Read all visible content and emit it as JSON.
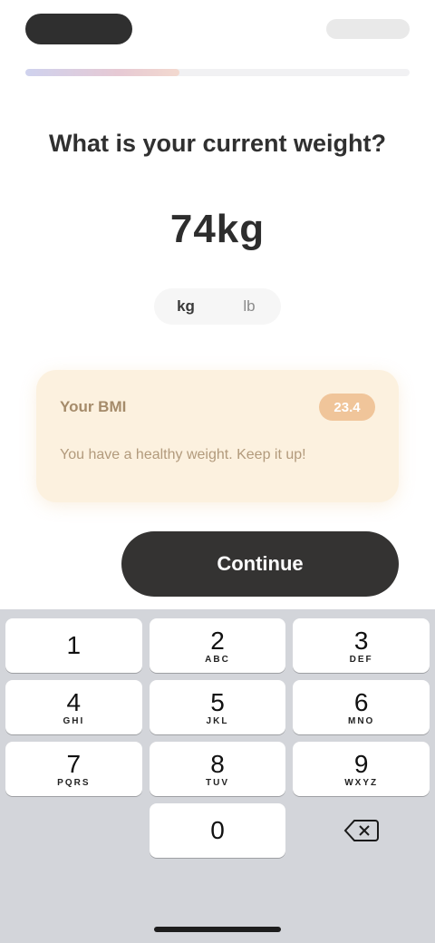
{
  "question": "What is your current weight?",
  "value": "74kg",
  "units": [
    "kg",
    "lb"
  ],
  "selected_unit": "kg",
  "info_card": {
    "title": "Your BMI",
    "badge": "23.4",
    "body": "You have a healthy weight. Keep it up!"
  },
  "progress": 0.4,
  "continue_label": "Continue",
  "keypad": [
    {
      "digit": "1",
      "letters": ""
    },
    {
      "digit": "2",
      "letters": "ABC"
    },
    {
      "digit": "3",
      "letters": "DEF"
    },
    {
      "digit": "4",
      "letters": "GHI"
    },
    {
      "digit": "5",
      "letters": "JKL"
    },
    {
      "digit": "6",
      "letters": "MNO"
    },
    {
      "digit": "7",
      "letters": "PQRS"
    },
    {
      "digit": "8",
      "letters": "TUV"
    },
    {
      "digit": "9",
      "letters": "WXYZ"
    },
    {
      "digit": "0",
      "letters": ""
    }
  ],
  "icons": {
    "delete": "backspace-icon"
  }
}
